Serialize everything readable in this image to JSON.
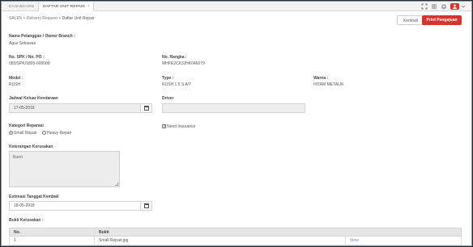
{
  "tabs": [
    {
      "label": "DASHBOARD"
    },
    {
      "label": "DAFTAR UNIT REPAIR",
      "close": "×"
    }
  ],
  "top_icons": [
    "expand-icon",
    "list-icon",
    "bell-icon",
    "user-avatar-icon",
    "chevron-down-icon"
  ],
  "breadcrumb": {
    "items": [
      "SALES",
      "Delivery Request",
      "Daftar Unit Repair"
    ],
    "separator": ">"
  },
  "actions": {
    "back": "Kembali",
    "print": "Print Pengajuan"
  },
  "customer": {
    "label": "Nama Pelanggan / Owner Branch :",
    "value": "Agus Setiawan"
  },
  "spk": {
    "label": "No. SPK / No. PO :",
    "value": "083/SPK/1805-000008"
  },
  "rangka": {
    "label": "No. Rangka :",
    "value": "MHFE2CK3JHK046079"
  },
  "model": {
    "label": "Model :",
    "value": "RUSH"
  },
  "type": {
    "label": "Type :",
    "value": "RUSH 1.5 S A/T"
  },
  "warna": {
    "label": "Warna :",
    "value": "HITAM METALIK"
  },
  "jadwal": {
    "label": "Jadwal Keluar Kendaraan",
    "value": "17-05-2018"
  },
  "driver": {
    "label": "Driver",
    "value": ""
  },
  "kategori": {
    "label": "Kategori Reparasi",
    "options": [
      {
        "label": "Small Repair",
        "checked": true
      },
      {
        "label": "Heavy Repair",
        "checked": false
      }
    ]
  },
  "insurance": {
    "label": "Need Insurance",
    "checked": true,
    "mark": "✓"
  },
  "keterangan": {
    "label": "Keterangan Kerusakan",
    "value": "Baret"
  },
  "estimasi": {
    "label": "Estimasi Tanggal Kembali",
    "value": "18-05-2018"
  },
  "bukti": {
    "label": "Bukti Kerusakan :",
    "columns": [
      "No.",
      "Bukti"
    ],
    "rows": [
      {
        "no": "1",
        "file": "Small Repair.jpg",
        "action": "View"
      }
    ]
  }
}
